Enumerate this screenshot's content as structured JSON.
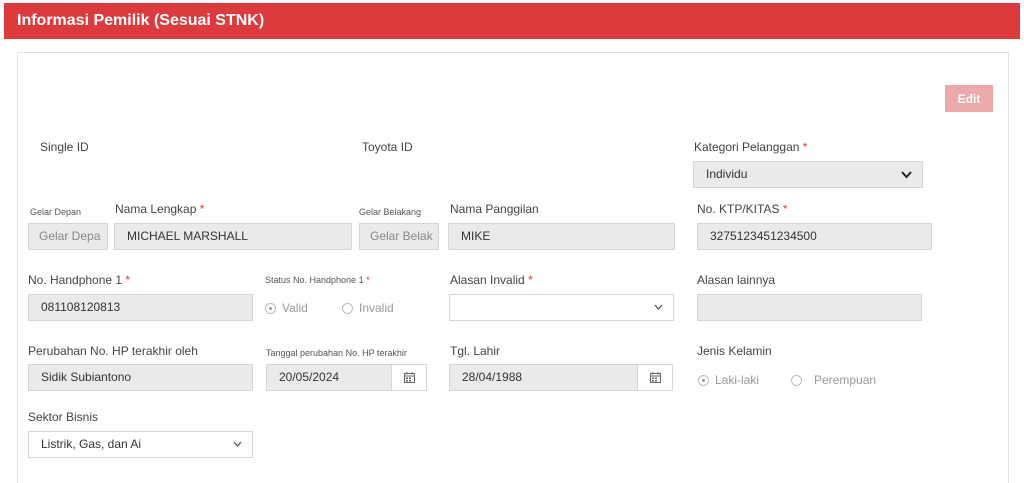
{
  "header": {
    "title": "Informasi Pemilik (Sesuai STNK)"
  },
  "actions": {
    "edit_label": "Edit"
  },
  "labels": {
    "single_id": "Single ID",
    "toyota_id": "Toyota ID",
    "kategori": "Kategori Pelanggan",
    "gelar_depan": "Gelar Depan",
    "nama_lengkap": "Nama Lengkap",
    "gelar_belakang": "Gelar Belakang",
    "nama_panggilan": "Nama Panggilan",
    "ktp": "No. KTP/KITAS",
    "handphone": "No. Handphone 1",
    "status_hp": "Status No. Handphone 1",
    "alasan_invalid": "Alasan Invalid",
    "alasan_lainnya": "Alasan lainnya",
    "perubahan_hp": "Perubahan No. HP terakhir oleh",
    "tanggal_perubahan": "Tanggal perubahan No. HP terakhir",
    "tgl_lahir": "Tgl. Lahir",
    "jenis_kelamin": "Jenis Kelamin",
    "sektor": "Sektor Bisnis",
    "required_mark": "*"
  },
  "values": {
    "kategori": "Individu",
    "gelar_depan_placeholder": "Gelar Depa",
    "nama_lengkap": "MICHAEL MARSHALL",
    "gelar_belakang_placeholder": "Gelar Belak",
    "nama_panggilan": "MIKE",
    "ktp": "3275123451234500",
    "handphone": "081108120813",
    "alasan_invalid": "",
    "alasan_lainnya": "",
    "perubahan_hp": "Sidik Subiantono",
    "tanggal_perubahan": "20/05/2024",
    "tgl_lahir": "28/04/1988",
    "sektor": "Listrik, Gas, dan Ai"
  },
  "options": {
    "status_valid": "Valid",
    "status_invalid": "Invalid",
    "status_selected": "Valid",
    "gender_male": "Laki-laki",
    "gender_female": "Perempuan",
    "gender_selected": "Laki-laki"
  },
  "icons": {
    "dropdown": "chevron-down-icon",
    "date": "calendar-icon"
  },
  "colors": {
    "brand_red": "#dc3a3c",
    "edit_disabled": "#ecaaaa"
  }
}
